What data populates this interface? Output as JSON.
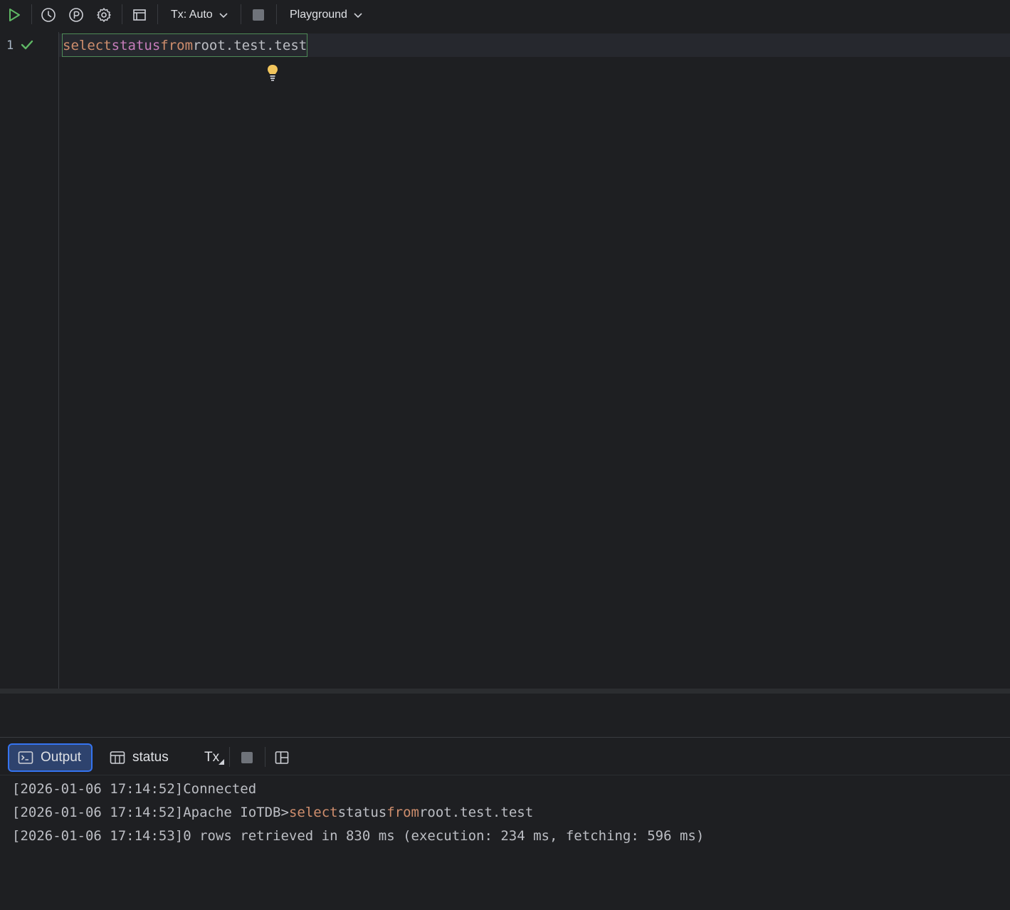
{
  "toolbar": {
    "tx_label": "Tx: Auto",
    "schema_label": "Playground"
  },
  "editor": {
    "line_number": "1",
    "code": {
      "kw1": "select",
      "col": "status",
      "kw2": "from",
      "table": "root.test.test"
    }
  },
  "bottom": {
    "tabs": {
      "output": "Output",
      "status": "status"
    },
    "tx_label": "Tx"
  },
  "output": [
    {
      "time": "[2026-01-06 17:14:52]",
      "text": "Connected"
    },
    {
      "time": "[2026-01-06 17:14:52]",
      "prompt": "Apache IoTDB>",
      "kw1": "select",
      "col": "status",
      "kw2": "from",
      "table": "root.test.test"
    },
    {
      "time": "[2026-01-06 17:14:53]",
      "text": "0 rows retrieved in 830 ms (execution: 234 ms, fetching: 596 ms)"
    }
  ],
  "colors": {
    "background": "#1e1f22",
    "keyword": "#cf8e6d",
    "identifier": "#c77dbb",
    "run_green": "#5fb865",
    "active_tab": "#2e436e",
    "accent": "#3574f0",
    "bulb": "#f2c55c"
  }
}
